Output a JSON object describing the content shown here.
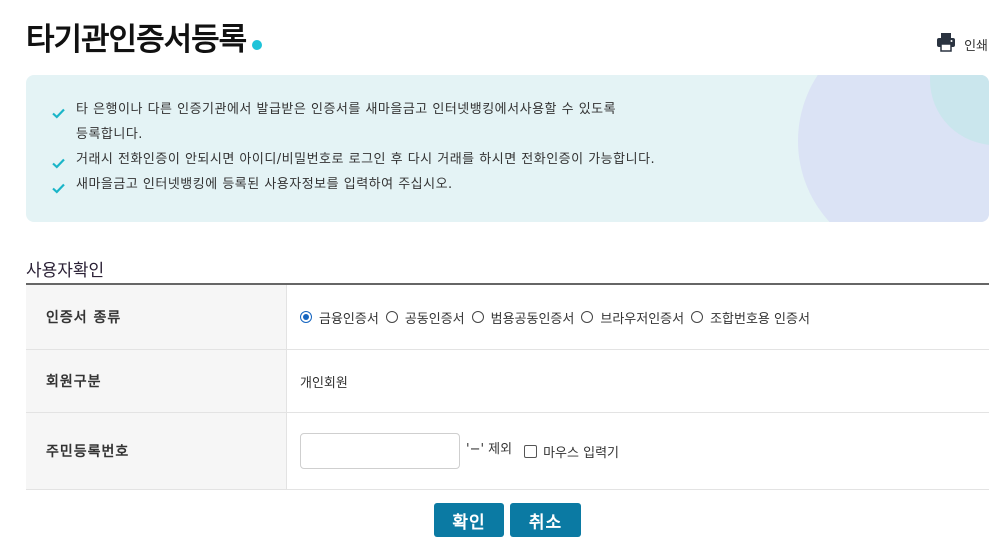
{
  "page": {
    "title": "타기관인증서등록",
    "print_label": "인쇄"
  },
  "notice": {
    "items": [
      {
        "line1": "타 은행이나 다른 인증기관에서 발급받은 인증서를 새마을금고 인터넷뱅킹에서사용할 수 있도록",
        "line2": "등록합니다."
      },
      {
        "line1": "거래시 전화인증이 안되시면 아이디/비밀번호로 로그인 후 다시 거래를 하시면 전화인증이 가능합니다.",
        "line2": ""
      },
      {
        "line1": "새마을금고 인터넷뱅킹에 등록된 사용자정보를 입력하여 주십시오.",
        "line2": ""
      }
    ]
  },
  "section": {
    "title": "사용자확인"
  },
  "form": {
    "cert_type": {
      "label": "인증서 종류",
      "options": [
        "금융인증서",
        "공동인증서",
        "범용공동인증서",
        "브라우저인증서",
        "조합번호용 인증서"
      ],
      "selected_index": 0
    },
    "member_type": {
      "label": "회원구분",
      "value": "개인회원"
    },
    "resident_no": {
      "label": "주민등록번호",
      "value": "",
      "placeholder": "",
      "hint": "'−' 제외",
      "mouse_input_label": "마우스 입력기",
      "mouse_input_checked": false
    }
  },
  "buttons": {
    "confirm": "확인",
    "cancel": "취소"
  },
  "colors": {
    "accent": "#0b7aa3",
    "dot": "#1ec3d9",
    "notice_bg": "#e4f3f5",
    "check": "#1ab5c8"
  }
}
